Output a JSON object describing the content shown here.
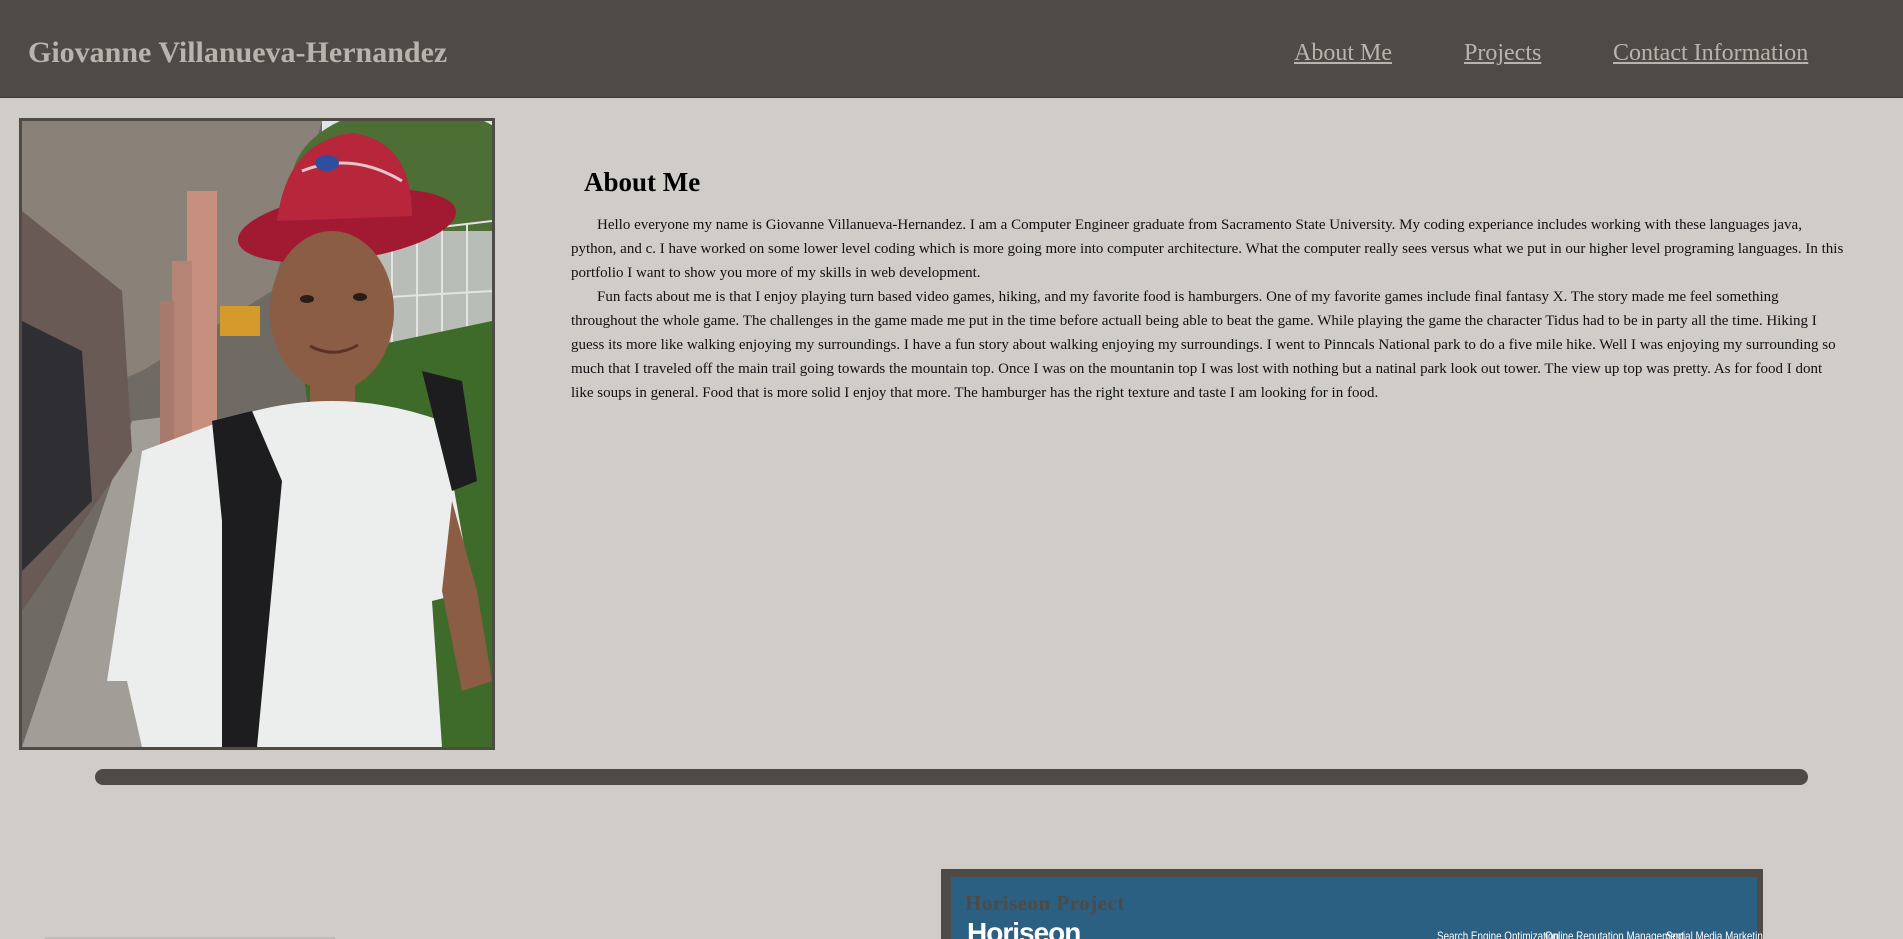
{
  "header": {
    "site_title": "Giovanne Villanueva-Hernandez",
    "nav": [
      "About Me",
      "Projects",
      "Contact Information"
    ]
  },
  "about": {
    "heading": "About Me",
    "paragraphs": [
      "Hello everyone my name is Giovanne Villanueva-Hernandez. I am a Computer Engineer graduate from Sacramento State University. My coding experiance includes working with these languages java, python, and c. I have worked on some lower level coding which is more going more into computer architecture. What the computer really sees versus what we put in our higher level programing languages. In this portfolio I want to show you more of my skills in web development.",
      "Fun facts about me is that I enjoy playing turn based video games, hiking, and my favorite food is hamburgers. One of my favorite games include final fantasy X. The story made me feel something throughout the whole game. The challenges in the game made me put in the time before actuall being able to beat the game. While playing the game the character Tidus had to be in party all the time. Hiking I guess its more like walking enjoying my surroundings. I have a fun story about walking enjoying my surroundings. I went to Pinncals National park to do a five mile hike. Well I was enjoying my surrounding so much that I traveled off the main trail going towards the mountain top. Once I was on the mountanin top I was lost with nothing but a natinal park look out tower. The view up top was pretty. As for food I dont like soups in general. Food that is more solid I enjoy that more. The hamburger has the right texture and taste I am looking for in food."
    ]
  },
  "projects": {
    "first": {
      "title": "Horiseon Project",
      "screenshot_brand": "Horiseon",
      "screenshot_nav": [
        "Search Engine Optimization",
        "Online Reputation Management",
        "Social Media Marketing"
      ]
    }
  },
  "colors": {
    "page_bg": "#d0cdc8",
    "header_bg": "#4e4b46",
    "header_text": "#b8b4ad",
    "project_bg": "#2b6083"
  }
}
